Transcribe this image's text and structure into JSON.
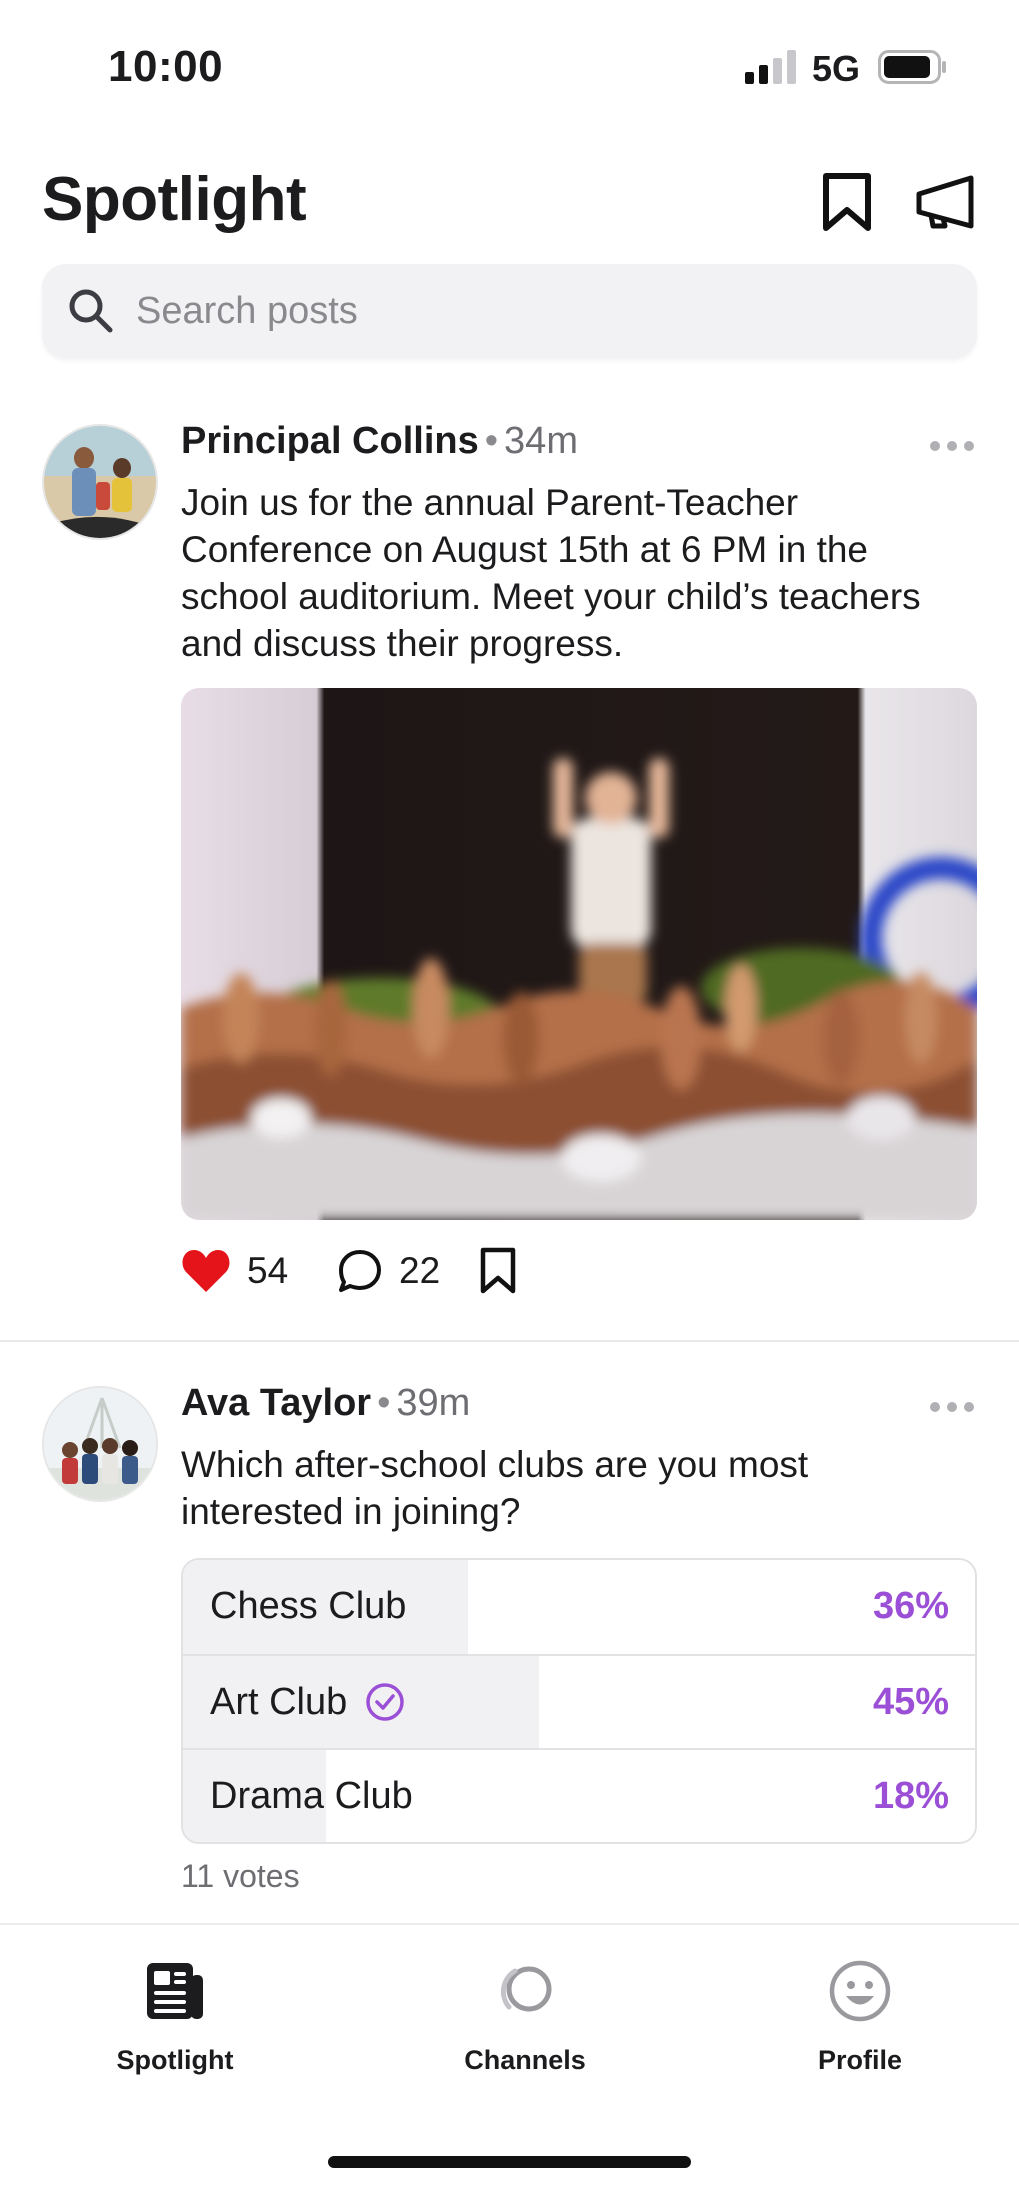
{
  "status_bar": {
    "time": "10:00",
    "network": "5G"
  },
  "header": {
    "title": "Spotlight",
    "icons": [
      "bookmark-icon",
      "megaphone-icon"
    ]
  },
  "search": {
    "placeholder": "Search posts",
    "value": ""
  },
  "posts": [
    {
      "author": "Principal Collins",
      "time": "34m",
      "body": "Join us for the annual Parent-Teacher Conference on August 15th at 6 PM in the school auditorium. Meet your child’s teachers and discuss their progress.",
      "likes": "54",
      "comments": "22",
      "liked": true
    },
    {
      "author": "Ava Taylor",
      "time": "39m",
      "body": "Which after-school clubs are you most interested in joining?",
      "poll": {
        "options": [
          {
            "label": "Chess Club",
            "percent": "36%",
            "fraction": 0.36,
            "selected": false
          },
          {
            "label": "Art Club",
            "percent": "45%",
            "fraction": 0.45,
            "selected": true
          },
          {
            "label": "Drama Club",
            "percent": "18%",
            "fraction": 0.18,
            "selected": false
          }
        ],
        "votes": "11 votes"
      }
    }
  ],
  "tab_bar": {
    "tabs": [
      {
        "label": "Spotlight",
        "icon": "newspaper-icon",
        "active": true
      },
      {
        "label": "Channels",
        "icon": "channels-icon",
        "active": false
      },
      {
        "label": "Profile",
        "icon": "smiley-icon",
        "active": false
      }
    ]
  },
  "colors": {
    "accent": "#9b4fd6",
    "like": "#e5141b",
    "text": "#1c1c1e",
    "muted": "#6d6d72"
  }
}
